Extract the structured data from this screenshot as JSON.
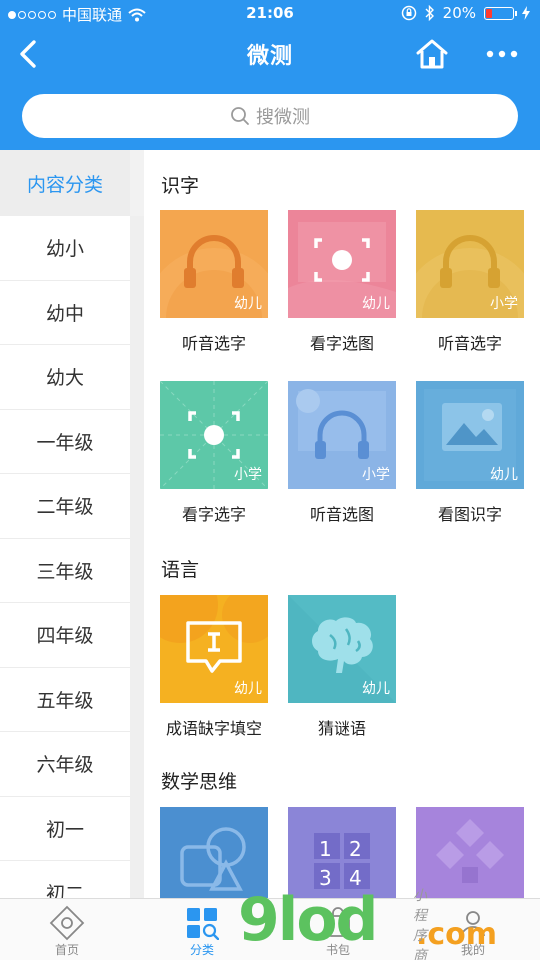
{
  "status": {
    "carrier": "中国联通",
    "time": "21:06",
    "battery": "20%",
    "battery_level": 0.2
  },
  "nav": {
    "title": "微测"
  },
  "search": {
    "placeholder": "搜微测"
  },
  "sidebar": {
    "header": "内容分类",
    "items": [
      "幼小",
      "幼中",
      "幼大",
      "一年级",
      "二年级",
      "三年级",
      "四年级",
      "五年级",
      "六年级",
      "初一",
      "初二"
    ]
  },
  "sections": [
    {
      "title": "识字",
      "cards": [
        {
          "label": "听音选字",
          "badge": "幼儿",
          "icon": "headphones-icon",
          "color": "#f2a24e"
        },
        {
          "label": "看字选图",
          "badge": "幼儿",
          "icon": "focus-frame-icon",
          "color": "#ec8599"
        },
        {
          "label": "听音选字",
          "badge": "小学",
          "icon": "headphones-icon",
          "color": "#e7bb4e"
        },
        {
          "label": "看字选字",
          "badge": "小学",
          "icon": "focus-frame-icon",
          "color": "#5cc8a8"
        },
        {
          "label": "听音选图",
          "badge": "小学",
          "icon": "headphones-icon",
          "color": "#8ab3e6"
        },
        {
          "label": "看图识字",
          "badge": "幼儿",
          "icon": "picture-icon",
          "color": "#5fa8d8"
        }
      ]
    },
    {
      "title": "语言",
      "cards": [
        {
          "label": "成语缺字填空",
          "badge": "幼儿",
          "icon": "speech-bubble-icon",
          "color": "#f5b020"
        },
        {
          "label": "猜谜语",
          "badge": "幼儿",
          "icon": "brain-icon",
          "color": "#4fb5c0"
        }
      ]
    },
    {
      "title": "数学思维",
      "cards": [
        {
          "label": "",
          "badge": "",
          "icon": "shapes-icon",
          "color": "#4b8fd0"
        },
        {
          "label": "",
          "badge": "",
          "icon": "number-grid-icon",
          "color": "#8a84d6",
          "grid": [
            "1",
            "2",
            "3",
            "4"
          ]
        },
        {
          "label": "",
          "badge": "",
          "icon": "diamonds-icon",
          "color": "#a683dc"
        }
      ]
    }
  ],
  "tabbar": [
    {
      "label": "首页",
      "icon": "home-diamond-icon"
    },
    {
      "label": "分类",
      "icon": "category-grid-icon"
    },
    {
      "label": "书包",
      "icon": "bag-icon"
    },
    {
      "label": "我的",
      "icon": "user-icon"
    }
  ],
  "watermark": {
    "big": "9lod",
    "com": ".com",
    "small": "小程序商店"
  }
}
